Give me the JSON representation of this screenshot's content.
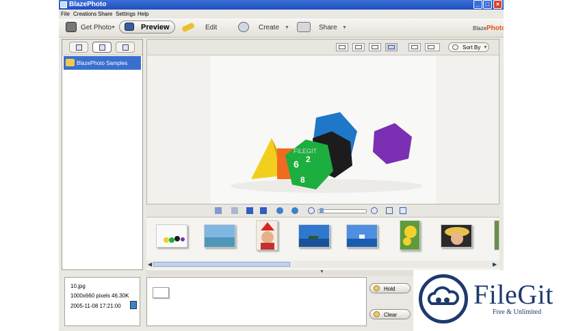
{
  "window": {
    "title": "BlazePhoto"
  },
  "menu": [
    "File",
    "Creations",
    "Share",
    "Settings",
    "Help"
  ],
  "toolbar": {
    "get_photo": "Get Photo",
    "preview": "Preview",
    "edit": "Edit",
    "create": "Create",
    "share": "Share",
    "brand_small": "Blaze",
    "brand_big": "Photo"
  },
  "sidebar": {
    "folder": "BlazePhoto Samples"
  },
  "viewer": {
    "sort_label": "Sort By",
    "watermark": "FILEGIT"
  },
  "info": {
    "filename": "10.jpg",
    "dimensions": "1000x660 pixels  46.30K",
    "date": "2005-11-08 17:21:00"
  },
  "hold": {
    "hold_label": "Hold",
    "clear_label": "Clear"
  },
  "filegit": {
    "name": "FileGit",
    "tagline": "Free & Unlimited"
  }
}
